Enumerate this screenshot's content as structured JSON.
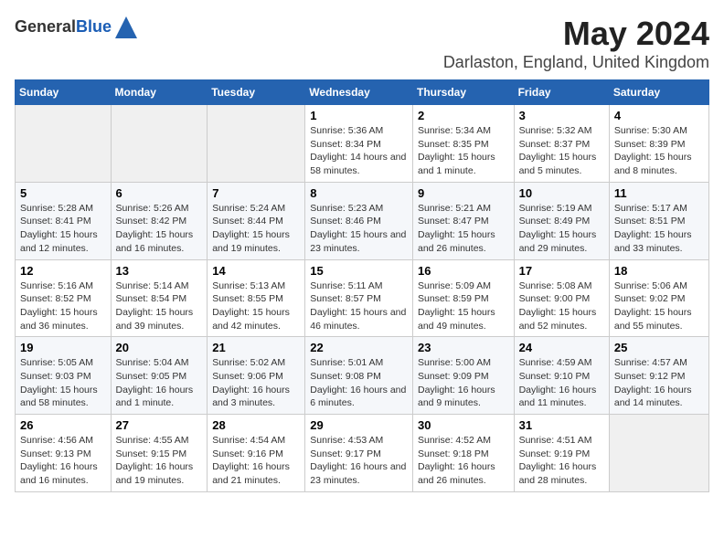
{
  "header": {
    "logo_general": "General",
    "logo_blue": "Blue",
    "title": "May 2024",
    "subtitle": "Darlaston, England, United Kingdom"
  },
  "weekdays": [
    "Sunday",
    "Monday",
    "Tuesday",
    "Wednesday",
    "Thursday",
    "Friday",
    "Saturday"
  ],
  "weeks": [
    [
      {
        "day": "",
        "sunrise": "",
        "sunset": "",
        "daylight": ""
      },
      {
        "day": "",
        "sunrise": "",
        "sunset": "",
        "daylight": ""
      },
      {
        "day": "",
        "sunrise": "",
        "sunset": "",
        "daylight": ""
      },
      {
        "day": "1",
        "sunrise": "Sunrise: 5:36 AM",
        "sunset": "Sunset: 8:34 PM",
        "daylight": "Daylight: 14 hours and 58 minutes."
      },
      {
        "day": "2",
        "sunrise": "Sunrise: 5:34 AM",
        "sunset": "Sunset: 8:35 PM",
        "daylight": "Daylight: 15 hours and 1 minute."
      },
      {
        "day": "3",
        "sunrise": "Sunrise: 5:32 AM",
        "sunset": "Sunset: 8:37 PM",
        "daylight": "Daylight: 15 hours and 5 minutes."
      },
      {
        "day": "4",
        "sunrise": "Sunrise: 5:30 AM",
        "sunset": "Sunset: 8:39 PM",
        "daylight": "Daylight: 15 hours and 8 minutes."
      }
    ],
    [
      {
        "day": "5",
        "sunrise": "Sunrise: 5:28 AM",
        "sunset": "Sunset: 8:41 PM",
        "daylight": "Daylight: 15 hours and 12 minutes."
      },
      {
        "day": "6",
        "sunrise": "Sunrise: 5:26 AM",
        "sunset": "Sunset: 8:42 PM",
        "daylight": "Daylight: 15 hours and 16 minutes."
      },
      {
        "day": "7",
        "sunrise": "Sunrise: 5:24 AM",
        "sunset": "Sunset: 8:44 PM",
        "daylight": "Daylight: 15 hours and 19 minutes."
      },
      {
        "day": "8",
        "sunrise": "Sunrise: 5:23 AM",
        "sunset": "Sunset: 8:46 PM",
        "daylight": "Daylight: 15 hours and 23 minutes."
      },
      {
        "day": "9",
        "sunrise": "Sunrise: 5:21 AM",
        "sunset": "Sunset: 8:47 PM",
        "daylight": "Daylight: 15 hours and 26 minutes."
      },
      {
        "day": "10",
        "sunrise": "Sunrise: 5:19 AM",
        "sunset": "Sunset: 8:49 PM",
        "daylight": "Daylight: 15 hours and 29 minutes."
      },
      {
        "day": "11",
        "sunrise": "Sunrise: 5:17 AM",
        "sunset": "Sunset: 8:51 PM",
        "daylight": "Daylight: 15 hours and 33 minutes."
      }
    ],
    [
      {
        "day": "12",
        "sunrise": "Sunrise: 5:16 AM",
        "sunset": "Sunset: 8:52 PM",
        "daylight": "Daylight: 15 hours and 36 minutes."
      },
      {
        "day": "13",
        "sunrise": "Sunrise: 5:14 AM",
        "sunset": "Sunset: 8:54 PM",
        "daylight": "Daylight: 15 hours and 39 minutes."
      },
      {
        "day": "14",
        "sunrise": "Sunrise: 5:13 AM",
        "sunset": "Sunset: 8:55 PM",
        "daylight": "Daylight: 15 hours and 42 minutes."
      },
      {
        "day": "15",
        "sunrise": "Sunrise: 5:11 AM",
        "sunset": "Sunset: 8:57 PM",
        "daylight": "Daylight: 15 hours and 46 minutes."
      },
      {
        "day": "16",
        "sunrise": "Sunrise: 5:09 AM",
        "sunset": "Sunset: 8:59 PM",
        "daylight": "Daylight: 15 hours and 49 minutes."
      },
      {
        "day": "17",
        "sunrise": "Sunrise: 5:08 AM",
        "sunset": "Sunset: 9:00 PM",
        "daylight": "Daylight: 15 hours and 52 minutes."
      },
      {
        "day": "18",
        "sunrise": "Sunrise: 5:06 AM",
        "sunset": "Sunset: 9:02 PM",
        "daylight": "Daylight: 15 hours and 55 minutes."
      }
    ],
    [
      {
        "day": "19",
        "sunrise": "Sunrise: 5:05 AM",
        "sunset": "Sunset: 9:03 PM",
        "daylight": "Daylight: 15 hours and 58 minutes."
      },
      {
        "day": "20",
        "sunrise": "Sunrise: 5:04 AM",
        "sunset": "Sunset: 9:05 PM",
        "daylight": "Daylight: 16 hours and 1 minute."
      },
      {
        "day": "21",
        "sunrise": "Sunrise: 5:02 AM",
        "sunset": "Sunset: 9:06 PM",
        "daylight": "Daylight: 16 hours and 3 minutes."
      },
      {
        "day": "22",
        "sunrise": "Sunrise: 5:01 AM",
        "sunset": "Sunset: 9:08 PM",
        "daylight": "Daylight: 16 hours and 6 minutes."
      },
      {
        "day": "23",
        "sunrise": "Sunrise: 5:00 AM",
        "sunset": "Sunset: 9:09 PM",
        "daylight": "Daylight: 16 hours and 9 minutes."
      },
      {
        "day": "24",
        "sunrise": "Sunrise: 4:59 AM",
        "sunset": "Sunset: 9:10 PM",
        "daylight": "Daylight: 16 hours and 11 minutes."
      },
      {
        "day": "25",
        "sunrise": "Sunrise: 4:57 AM",
        "sunset": "Sunset: 9:12 PM",
        "daylight": "Daylight: 16 hours and 14 minutes."
      }
    ],
    [
      {
        "day": "26",
        "sunrise": "Sunrise: 4:56 AM",
        "sunset": "Sunset: 9:13 PM",
        "daylight": "Daylight: 16 hours and 16 minutes."
      },
      {
        "day": "27",
        "sunrise": "Sunrise: 4:55 AM",
        "sunset": "Sunset: 9:15 PM",
        "daylight": "Daylight: 16 hours and 19 minutes."
      },
      {
        "day": "28",
        "sunrise": "Sunrise: 4:54 AM",
        "sunset": "Sunset: 9:16 PM",
        "daylight": "Daylight: 16 hours and 21 minutes."
      },
      {
        "day": "29",
        "sunrise": "Sunrise: 4:53 AM",
        "sunset": "Sunset: 9:17 PM",
        "daylight": "Daylight: 16 hours and 23 minutes."
      },
      {
        "day": "30",
        "sunrise": "Sunrise: 4:52 AM",
        "sunset": "Sunset: 9:18 PM",
        "daylight": "Daylight: 16 hours and 26 minutes."
      },
      {
        "day": "31",
        "sunrise": "Sunrise: 4:51 AM",
        "sunset": "Sunset: 9:19 PM",
        "daylight": "Daylight: 16 hours and 28 minutes."
      },
      {
        "day": "",
        "sunrise": "",
        "sunset": "",
        "daylight": ""
      }
    ]
  ]
}
